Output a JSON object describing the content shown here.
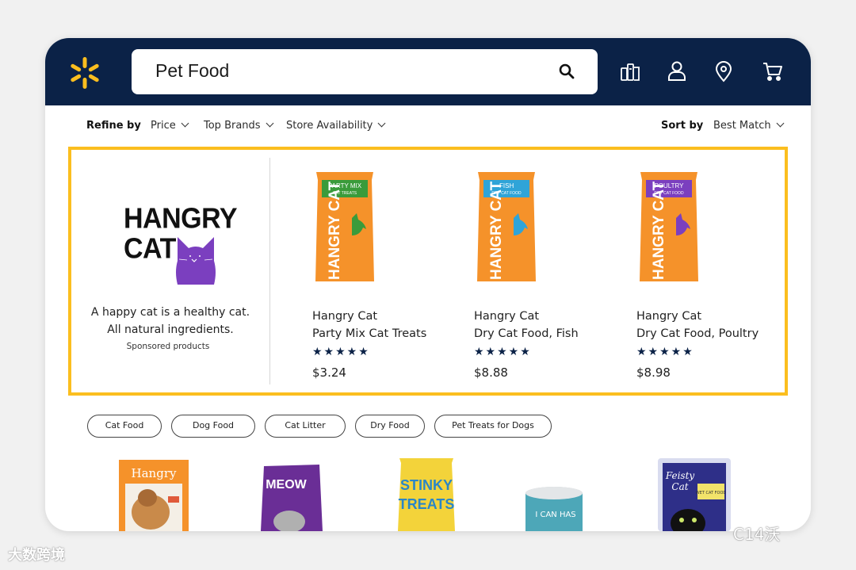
{
  "search": {
    "query": "Pet Food"
  },
  "header_icons": [
    "reorder-icon",
    "account-icon",
    "location-icon",
    "cart-icon"
  ],
  "refine": {
    "label": "Refine by",
    "filters": [
      "Price",
      "Top Brands",
      "Store Availability"
    ],
    "sort_label": "Sort by",
    "sort_value": "Best Match"
  },
  "sponsored": {
    "brand_line1": "HANGRY",
    "brand_line2": "CAT",
    "tagline_line1": "A happy cat is a healthy cat.",
    "tagline_line2": "All natural ingredients.",
    "label": "Sponsored products",
    "products": [
      {
        "brand": "Hangry Cat",
        "name": "Party Mix Cat Treats",
        "stars": "★★★★★",
        "price": "$3.24",
        "bag_label": "PARTY MIX",
        "bag_sub": "CAT TREATS",
        "bag_title": "HANGRY CAT"
      },
      {
        "brand": "Hangry Cat",
        "name": "Dry Cat Food, Fish",
        "stars": "★★★★★",
        "price": "$8.88",
        "bag_label": "FISH",
        "bag_sub": "DRY CAT FOOD",
        "bag_title": "HANGRY CAT"
      },
      {
        "brand": "Hangry Cat",
        "name": "Dry Cat Food, Poultry",
        "stars": "★★★★★",
        "price": "$8.98",
        "bag_label": "POULTRY",
        "bag_sub": "DRY CAT FOOD",
        "bag_title": "HANGRY CAT"
      }
    ]
  },
  "chips": [
    "Cat Food",
    "Dog Food",
    "Cat Litter",
    "Dry Food",
    "Pet Treats for Dogs"
  ],
  "thumbnails": [
    {
      "label": "Hangry"
    },
    {
      "label": "MEOW"
    },
    {
      "label1": "STINKY",
      "label2": "TREATS"
    },
    {
      "label": "I CAN HAS"
    },
    {
      "label1": "Feisty",
      "label2": "Cat",
      "label3": "WET CAT FOOD"
    }
  ],
  "colors": {
    "header_bg": "#0b2247",
    "spark_yellow": "#fbbe1f",
    "bag_orange": "#f5922a",
    "party_green": "#3a9b3b",
    "fish_blue": "#2fa4d8",
    "poultry_purple": "#7b3fbf"
  },
  "watermarks": {
    "left": "大数跨境",
    "right": "C14沃"
  }
}
